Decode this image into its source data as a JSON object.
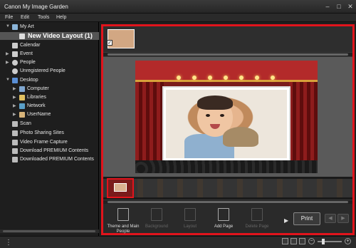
{
  "window": {
    "title": "Canon My Image Garden",
    "controls": {
      "minimize": "–",
      "maximize": "□",
      "close": "✕"
    }
  },
  "menu": [
    "File",
    "Edit",
    "Tools",
    "Help"
  ],
  "sidebar": {
    "items": [
      {
        "label": "My Art",
        "arrow": "▼",
        "icon": "my-art-icon"
      },
      {
        "label": "New Video Layout (1)",
        "icon": "video-layout-icon",
        "selected": true
      },
      {
        "label": "Calendar",
        "icon": "calendar-icon"
      },
      {
        "label": "Event",
        "arrow": "▶",
        "icon": "event-icon"
      },
      {
        "label": "People",
        "arrow": "▶",
        "icon": "people-icon"
      },
      {
        "label": "Unregistered People",
        "icon": "unregistered-people-icon"
      },
      {
        "label": "Desktop",
        "arrow": "▼",
        "icon": "desktop-icon"
      },
      {
        "label": "Computer",
        "arrow": "▶",
        "icon": "computer-icon"
      },
      {
        "label": "Libraries",
        "arrow": "▶",
        "icon": "libraries-icon"
      },
      {
        "label": "Network",
        "arrow": "▶",
        "icon": "network-icon"
      },
      {
        "label": "UserName",
        "arrow": "▶",
        "icon": "user-folder-icon"
      },
      {
        "label": "Scan",
        "icon": "scan-icon"
      },
      {
        "label": "Photo Sharing Sites",
        "icon": "photo-sharing-icon"
      },
      {
        "label": "Video Frame Capture",
        "icon": "video-frame-icon"
      },
      {
        "label": "Download PREMIUM Contents",
        "icon": "download-premium-icon"
      },
      {
        "label": "Downloaded PREMIUM Contents",
        "icon": "downloaded-premium-icon"
      }
    ]
  },
  "toolbar": {
    "theme_label": "Theme and Main People",
    "background_label": "Background",
    "layout_label": "Layout",
    "add_page_label": "Add Page",
    "delete_page_label": "Delete Page",
    "more_arrow": "▶",
    "print_label": "Print",
    "prev": "◀",
    "next": "▶"
  },
  "statusbar": {
    "menu_icon": "⋮"
  },
  "zoom": {
    "minus": "−",
    "plus": "+"
  },
  "colors": {
    "accent_frame": "#e1141c"
  }
}
